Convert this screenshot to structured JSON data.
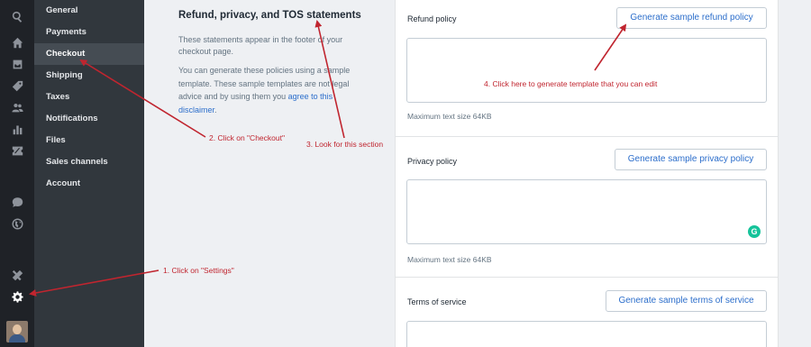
{
  "rail": {
    "icons": [
      "search-icon",
      "home-icon",
      "orders-icon",
      "products-icon",
      "customers-icon",
      "analytics-icon",
      "discounts-icon",
      "chat-icon",
      "globe-icon",
      "apps-icon",
      "settings-icon"
    ]
  },
  "nav": {
    "items": [
      {
        "label": "General"
      },
      {
        "label": "Payments"
      },
      {
        "label": "Checkout",
        "active": true
      },
      {
        "label": "Shipping"
      },
      {
        "label": "Taxes"
      },
      {
        "label": "Notifications"
      },
      {
        "label": "Files"
      },
      {
        "label": "Sales channels"
      },
      {
        "label": "Account"
      }
    ]
  },
  "section": {
    "title": "Refund, privacy, and TOS statements",
    "paragraph1": "These statements appear in the footer of your checkout page.",
    "paragraph2": "You can generate these policies using a sample template. These sample templates are not legal advice and by using them you",
    "link": "agree to this disclaimer",
    "link_suffix": "."
  },
  "policies": {
    "refund": {
      "label": "Refund policy",
      "button": "Generate sample refund policy",
      "value": "",
      "help": "Maximum text size 64KB"
    },
    "privacy": {
      "label": "Privacy policy",
      "button": "Generate sample privacy policy",
      "value": "",
      "help": "Maximum text size 64KB"
    },
    "terms": {
      "label": "Terms of service",
      "button": "Generate sample terms of service",
      "value": ""
    }
  },
  "grammarly": "G",
  "annotations": {
    "a1": "1. Click on \"Settings\"",
    "a2": "2. Click on \"Checkout\"",
    "a3": "3. Look for this section",
    "a4": "4. Click here to generate template that you can edit"
  },
  "colors": {
    "annotation": "#c0252f",
    "link": "#2c6ecb",
    "sidebar": "#31373d",
    "rail": "#1f2227"
  }
}
